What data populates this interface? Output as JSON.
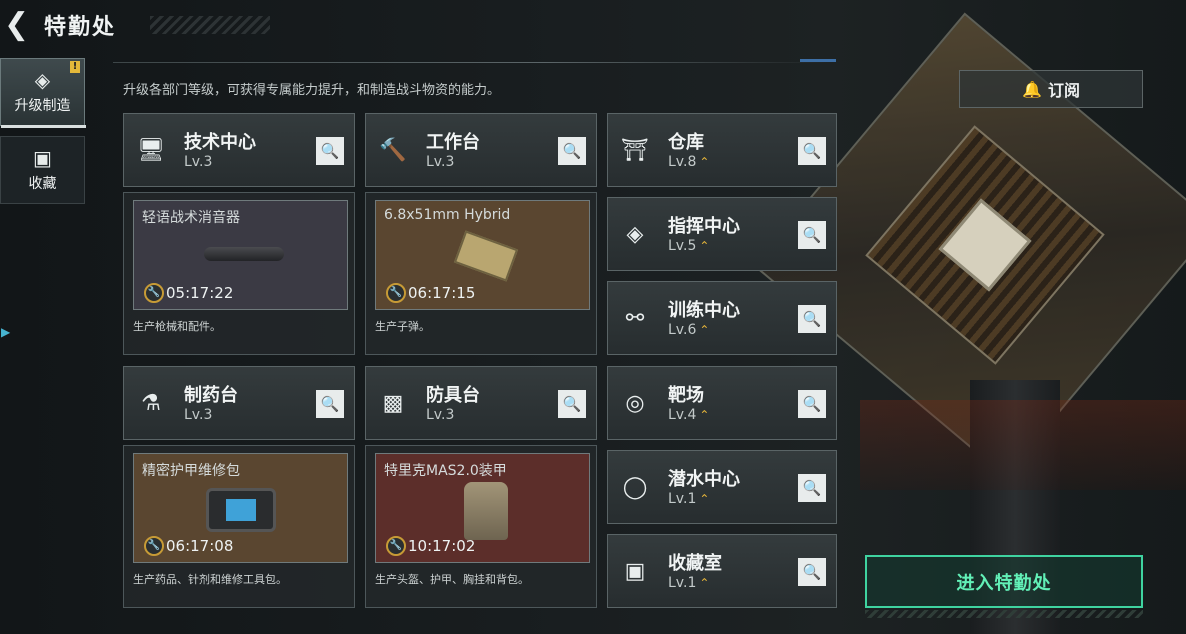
{
  "header": {
    "title": "特勤处"
  },
  "sidebar": {
    "items": [
      {
        "label": "升级制造",
        "badge": "!",
        "icon": "upgrade-icon"
      },
      {
        "label": "收藏",
        "icon": "collection-icon"
      }
    ]
  },
  "description": "升级各部门等级，可获得专属能力提升，和制造战斗物资的能力。",
  "subscribe": {
    "label": "订阅",
    "icon": "bell-icon"
  },
  "production": [
    {
      "name": "技术中心",
      "level": "Lv.3",
      "icon": "computer-icon",
      "item": "轻语战术消音器",
      "time": "05:17:22",
      "desc": "生产枪械和配件。",
      "color": "#3b3a44"
    },
    {
      "name": "工作台",
      "level": "Lv.3",
      "icon": "tools-icon",
      "item": "6.8x51mm Hybrid",
      "time": "06:17:15",
      "desc": "生产子弹。",
      "color": "#5a4630"
    },
    {
      "name": "制药台",
      "level": "Lv.3",
      "icon": "microscope-icon",
      "item": "精密护甲维修包",
      "time": "06:17:08",
      "desc": "生产药品、针剂和维修工具包。",
      "color": "#5a4630"
    },
    {
      "name": "防具台",
      "level": "Lv.3",
      "icon": "cubes-icon",
      "item": "特里克MAS2.0装甲",
      "time": "10:17:02",
      "desc": "生产头盔、护甲、胸挂和背包。",
      "color": "#5c2e2a"
    }
  ],
  "facilities": [
    {
      "name": "仓库",
      "level": "Lv.8",
      "icon": "warehouse-icon",
      "upgrade": true
    },
    {
      "name": "指挥中心",
      "level": "Lv.5",
      "icon": "command-icon",
      "upgrade": true
    },
    {
      "name": "训练中心",
      "level": "Lv.6",
      "icon": "dumbbell-icon",
      "upgrade": true
    },
    {
      "name": "靶场",
      "level": "Lv.4",
      "icon": "target-icon",
      "upgrade": true
    },
    {
      "name": "潜水中心",
      "level": "Lv.1",
      "icon": "diving-mask-icon",
      "upgrade": true
    },
    {
      "name": "收藏室",
      "level": "Lv.1",
      "icon": "collection-room-icon",
      "upgrade": true
    }
  ],
  "enter_button": {
    "label": "进入特勤处"
  }
}
